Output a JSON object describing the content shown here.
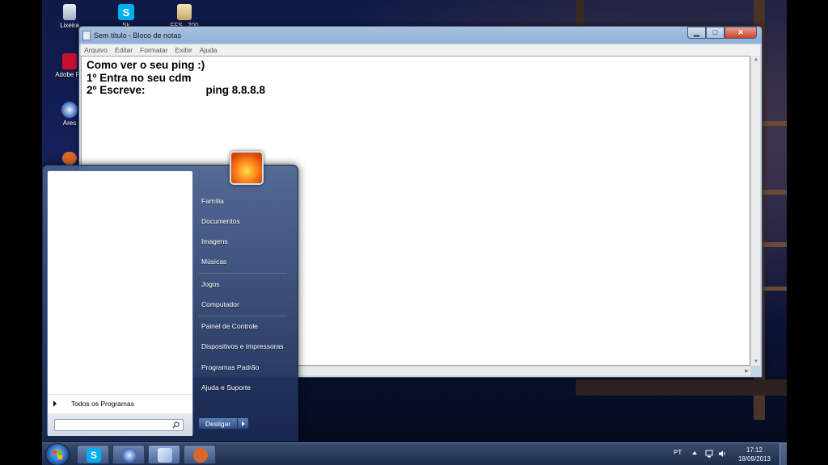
{
  "desktop": {
    "icons": [
      {
        "label": "Lixeira",
        "icon": "recycle-bin-icon"
      },
      {
        "label": "Sk",
        "icon": "skype-icon"
      },
      {
        "label": "FFS...200",
        "icon": "file-icon"
      },
      {
        "label": "Adobe Re",
        "icon": "adobe-reader-icon"
      },
      {
        "label": "Ares",
        "icon": "ares-icon"
      },
      {
        "label": "",
        "icon": "baseball-glove-icon"
      }
    ]
  },
  "notepad": {
    "title": "Sem título - Bloco de notas",
    "menu": [
      "Arquivo",
      "Editar",
      "Formatar",
      "Exibir",
      "Ajuda"
    ],
    "lines": [
      "Como ver o seu ping :)",
      "1º Entra no seu cdm",
      "2º Escreve:                    ping 8.8.8.8"
    ],
    "buttons": {
      "minimize": "▁",
      "maximize": "□",
      "close": "✕"
    }
  },
  "start_menu": {
    "right_items": [
      "Família",
      "Documentos",
      "Imagens",
      "Músicas",
      "Jogos",
      "Computador",
      "Painel de Controle",
      "Dispositivos e Impressoras",
      "Programas Padrão",
      "Ajuda e Suporte"
    ],
    "all_programs": "Todos os Programas",
    "search_placeholder": "",
    "shutdown_label": "Desligar"
  },
  "taskbar": {
    "pinned": [
      "skype-icon",
      "ares-icon",
      "notepad-icon",
      "baseball-glove-icon"
    ],
    "language": "PT",
    "time": "17:12",
    "date": "18/09/2013"
  },
  "colors": {
    "skype": "#00aff0",
    "adobe": "#c8102e",
    "orb": "#3a7ad0"
  }
}
